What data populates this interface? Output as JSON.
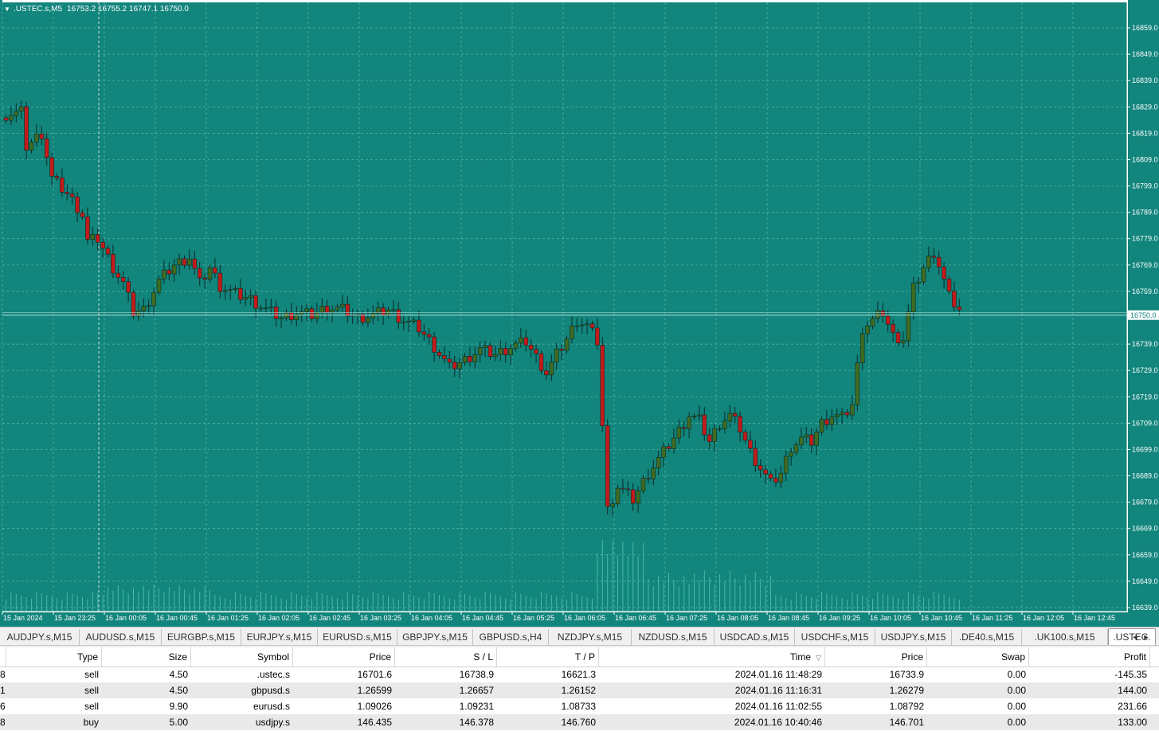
{
  "chart": {
    "symbol": ".USTEC.s,M5",
    "ohlc": "16753.2 16755.2 16747.1 16750.0",
    "colors": {
      "background": "#12857c",
      "grid": "#5fb8b0",
      "bull": "#3f6b22",
      "bear": "#c41a1a",
      "wick": "#0a2a26",
      "volume": "#47b8ad",
      "axis_text": "#ffffff"
    },
    "price_axis": {
      "labels": [
        "16859.0",
        "16849.0",
        "16839.0",
        "16829.0",
        "16819.0",
        "16809.0",
        "16799.0",
        "16789.0",
        "16779.0",
        "16769.0",
        "16759.0",
        "16739.0",
        "16729.0",
        "16719.0",
        "16709.0",
        "16699.0",
        "16689.0",
        "16679.0",
        "16669.0",
        "16659.0",
        "16649.0",
        "16639.0"
      ],
      "current_price": "16750.0",
      "min": 16639.0,
      "max": 16859.0
    },
    "time_axis": {
      "labels": [
        "15 Jan 2024",
        "15 Jan 23:25",
        "16 Jan 00:05",
        "16 Jan 00:45",
        "16 Jan 01:25",
        "16 Jan 02:05",
        "16 Jan 02:45",
        "16 Jan 03:25",
        "16 Jan 04:05",
        "16 Jan 04:45",
        "16 Jan 05:25",
        "16 Jan 06:05",
        "16 Jan 06:45",
        "16 Jan 07:25",
        "16 Jan 08:05",
        "16 Jan 08:45",
        "16 Jan 09:25",
        "16 Jan 10:05",
        "16 Jan 10:45",
        "16 Jan 11:25",
        "16 Jan 12:05",
        "16 Jan 12:45"
      ]
    },
    "close_path": [
      [
        0,
        16826
      ],
      [
        3,
        16827
      ],
      [
        4,
        16814
      ],
      [
        7,
        16819
      ],
      [
        9,
        16802
      ],
      [
        12,
        16796
      ],
      [
        14,
        16791
      ],
      [
        15,
        16788
      ],
      [
        16,
        16778
      ],
      [
        18,
        16779
      ],
      [
        21,
        16768
      ],
      [
        23,
        16762
      ],
      [
        25,
        16751
      ],
      [
        27,
        16752
      ],
      [
        30,
        16763
      ],
      [
        33,
        16769
      ],
      [
        36,
        16772
      ],
      [
        38,
        16762
      ],
      [
        40,
        16768
      ],
      [
        42,
        16761
      ],
      [
        45,
        16758
      ],
      [
        48,
        16756
      ],
      [
        51,
        16752
      ],
      [
        54,
        16749
      ],
      [
        57,
        16751
      ],
      [
        60,
        16750
      ],
      [
        63,
        16753
      ],
      [
        66,
        16752
      ],
      [
        69,
        16749
      ],
      [
        72,
        16750
      ],
      [
        75,
        16752
      ],
      [
        78,
        16748
      ],
      [
        81,
        16745
      ],
      [
        84,
        16738
      ],
      [
        87,
        16730
      ],
      [
        90,
        16733
      ],
      [
        93,
        16737
      ],
      [
        96,
        16735
      ],
      [
        99,
        16738
      ],
      [
        102,
        16740
      ],
      [
        104,
        16734
      ],
      [
        106,
        16728
      ],
      [
        108,
        16735
      ],
      [
        110,
        16741
      ],
      [
        112,
        16748
      ],
      [
        114,
        16746
      ],
      [
        116,
        16740
      ],
      [
        118,
        16676
      ],
      [
        120,
        16685
      ],
      [
        123,
        16680
      ],
      [
        126,
        16690
      ],
      [
        129,
        16698
      ],
      [
        132,
        16706
      ],
      [
        134,
        16712
      ],
      [
        136,
        16710
      ],
      [
        138,
        16702
      ],
      [
        140,
        16709
      ],
      [
        142,
        16712
      ],
      [
        144,
        16707
      ],
      [
        146,
        16698
      ],
      [
        148,
        16692
      ],
      [
        150,
        16686
      ],
      [
        152,
        16690
      ],
      [
        154,
        16700
      ],
      [
        156,
        16703
      ],
      [
        158,
        16702
      ],
      [
        160,
        16709
      ],
      [
        162,
        16712
      ],
      [
        164,
        16711
      ],
      [
        166,
        16716
      ],
      [
        168,
        16745
      ],
      [
        170,
        16748
      ],
      [
        172,
        16751
      ],
      [
        174,
        16742
      ],
      [
        176,
        16741
      ],
      [
        178,
        16760
      ],
      [
        180,
        16768
      ],
      [
        182,
        16774
      ],
      [
        183,
        16769
      ],
      [
        185,
        16757
      ],
      [
        187,
        16752
      ]
    ],
    "candle_count": 188
  },
  "tabs": {
    "items": [
      "AUDJPY.s,M15",
      "AUDUSD.s,M15",
      "EURGBP.s,M15",
      "EURJPY.s,M15",
      "EURUSD.s,M15",
      "GBPJPY.s,M15",
      "GBPUSD.s,H4",
      "NZDJPY.s,M15",
      "NZDUSD.s,M15",
      "USDCAD.s,M15",
      "USDCHF.s,M15",
      "USDJPY.s,M15",
      ".DE40.s,M15",
      ".UK100.s,M15",
      ".USTEC."
    ],
    "active": ".USTEC.",
    "scroll_left": "◄",
    "scroll_right": "►"
  },
  "trades": {
    "columns": [
      "",
      "Type",
      "Size",
      "Symbol",
      "Price",
      "S / L",
      "T / P",
      "Time",
      "Price",
      "Swap",
      "Profit"
    ],
    "sort_icon": "▽",
    "rows": [
      {
        "id_tail": "8",
        "type": "sell",
        "size": "4.50",
        "symbol": ".ustec.s",
        "price": "16701.6",
        "sl": "16738.9",
        "tp": "16621.3",
        "time": "2024.01.16 11:48:29",
        "cur_price": "16733.9",
        "swap": "0.00",
        "profit": "-145.35"
      },
      {
        "id_tail": "1",
        "type": "sell",
        "size": "4.50",
        "symbol": "gbpusd.s",
        "price": "1.26599",
        "sl": "1.26657",
        "tp": "1.26152",
        "time": "2024.01.16 11:16:31",
        "cur_price": "1.26279",
        "swap": "0.00",
        "profit": "144.00"
      },
      {
        "id_tail": "6",
        "type": "sell",
        "size": "9.90",
        "symbol": "eurusd.s",
        "price": "1.09026",
        "sl": "1.09231",
        "tp": "1.08733",
        "time": "2024.01.16 11:02:55",
        "cur_price": "1.08792",
        "swap": "0.00",
        "profit": "231.66"
      },
      {
        "id_tail": "8",
        "type": "buy",
        "size": "5.00",
        "symbol": "usdjpy.s",
        "price": "146.435",
        "sl": "146.378",
        "tp": "146.760",
        "time": "2024.01.16 10:40:46",
        "cur_price": "146.701",
        "swap": "0.00",
        "profit": "133.00"
      }
    ]
  }
}
